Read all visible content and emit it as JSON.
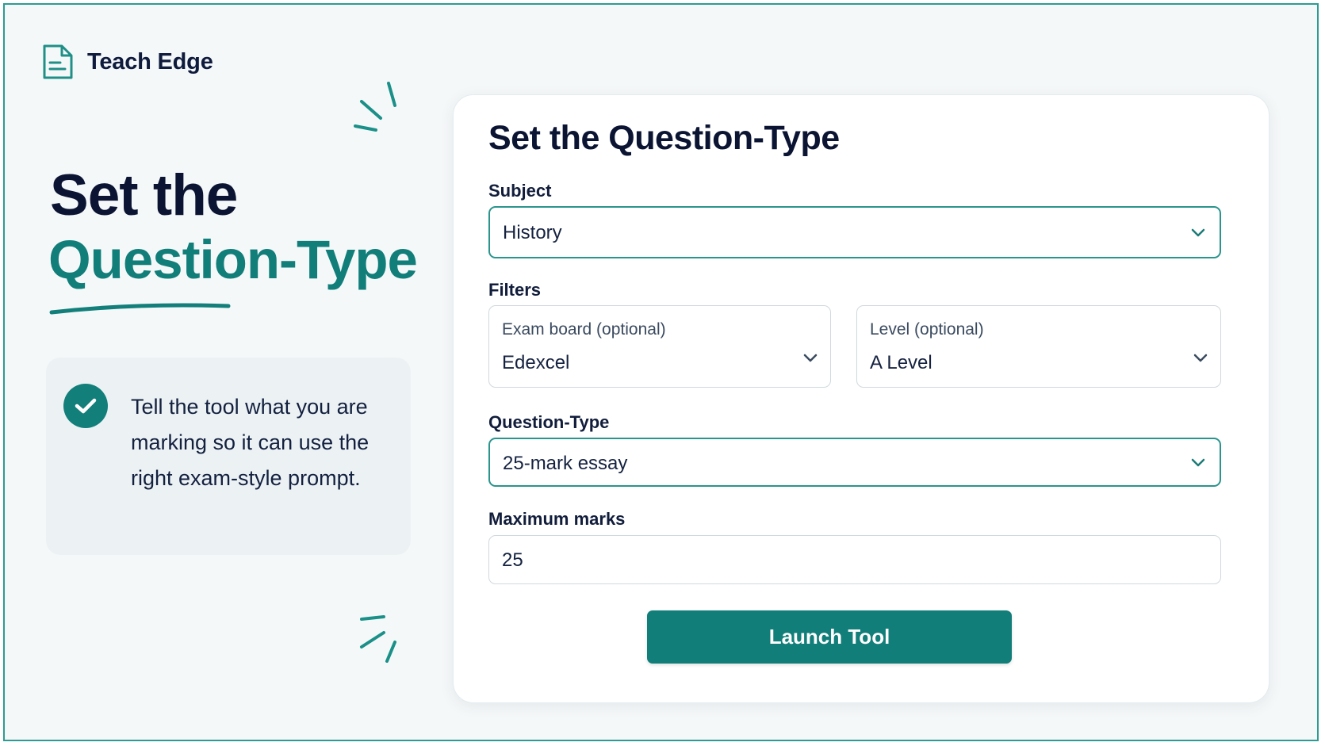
{
  "brand": {
    "name": "Teach Edge",
    "accent": "#117e7a",
    "logo_icon": "document-icon"
  },
  "hero": {
    "line1": "Set the",
    "line2": "Question-Type"
  },
  "note": {
    "icon": "checkmark-circle-icon",
    "text": "Tell the tool what you are marking so it can use the right exam-style prompt."
  },
  "form": {
    "title": "Set the Question-Type",
    "subject": {
      "label": "Subject",
      "value": "History"
    },
    "filters": {
      "label": "Filters",
      "exam_board": {
        "label": "Exam board (optional)",
        "value": "Edexcel"
      },
      "level": {
        "label": "Level (optional)",
        "value": "A Level"
      }
    },
    "question_type": {
      "label": "Question-Type",
      "value": "25-mark essay"
    },
    "max_marks": {
      "label": "Maximum marks",
      "value": "25"
    },
    "launch_label": "Launch Tool"
  }
}
